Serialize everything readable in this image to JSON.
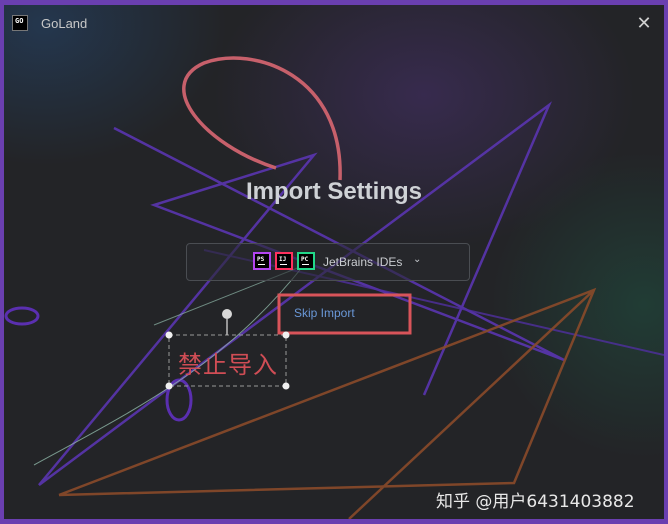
{
  "window": {
    "app_icon_text": "GO",
    "title": "GoLand",
    "close_glyph": "✕"
  },
  "main": {
    "heading": "Import Settings",
    "ide_select": {
      "icons": [
        {
          "name": "phpstorm-icon",
          "text": "PS",
          "color": "#b345f1"
        },
        {
          "name": "intellij-idea-icon",
          "text": "IJ",
          "color": "#fe315d"
        },
        {
          "name": "pycharm-icon",
          "text": "PC",
          "color": "#21d789"
        }
      ],
      "label": "JetBrains IDEs",
      "chevron": "⌄"
    },
    "skip_label": "Skip Import"
  },
  "annotation": {
    "label": "禁止导入",
    "highlight_color": "#d8545a"
  },
  "watermark": "知乎 @用户6431403882"
}
